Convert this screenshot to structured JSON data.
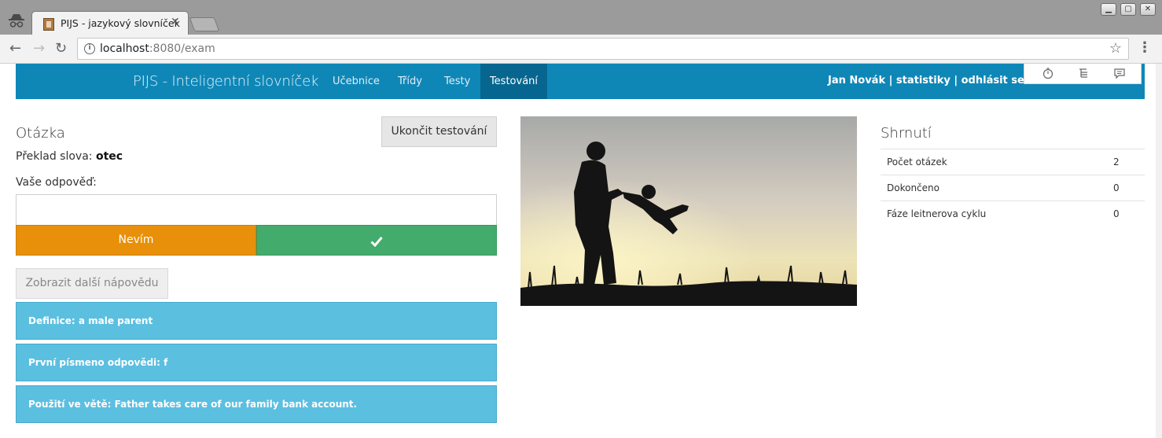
{
  "browser": {
    "tab_title": "PIJS - jazykový slovníček",
    "url_host": "localhost",
    "url_rest": ":8080/exam",
    "window_controls": {
      "minimize": "▁",
      "maximize": "▢",
      "close": "✕"
    }
  },
  "navbar": {
    "brand": "PIJS - Inteligentní slovníček",
    "links": [
      "Učebnice",
      "Třídy",
      "Testy",
      "Testování"
    ],
    "active": "Testování",
    "user_links": "Jan Novák | statistiky | odhlásit se",
    "colors": {
      "bar": "#0e87b7",
      "active": "#07668f"
    }
  },
  "question": {
    "heading": "Otázka",
    "end_button": "Ukončit testování",
    "word_label": "Překlad slova:",
    "word": "otec",
    "answer_label": "Vaše odpověď:",
    "answer_value": "",
    "dont_know_button": "Nevím",
    "confirm_icon": "check-icon",
    "hint_button": "Zobrazit další nápovědu",
    "hints": [
      "Definice: a male parent",
      "První písmeno odpovědi: f",
      "Použití ve větě: Father takes care of our family bank account."
    ],
    "colors": {
      "dont_know": "#e8900a",
      "confirm": "#43ab6b",
      "hint": "#5bbfe0"
    }
  },
  "summary": {
    "heading": "Shrnutí",
    "rows": [
      {
        "label": "Počet otázek",
        "value": "2"
      },
      {
        "label": "Dokončeno",
        "value": "0"
      },
      {
        "label": "Fáze leitnerova cyklu",
        "value": "0"
      }
    ]
  }
}
